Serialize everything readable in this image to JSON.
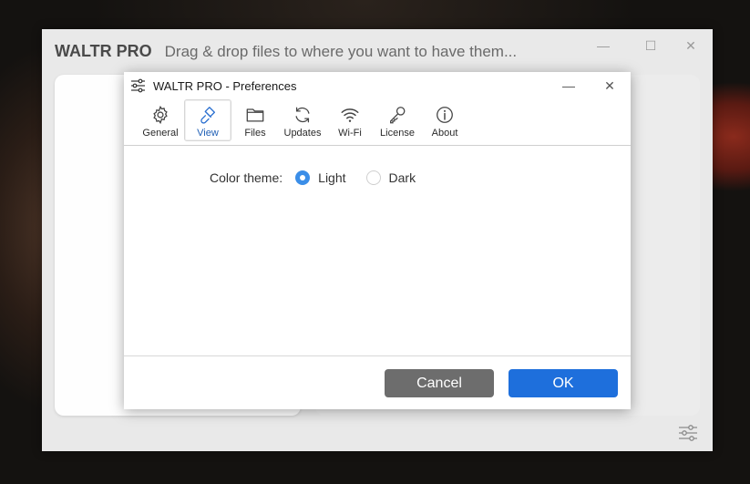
{
  "main_window": {
    "app_name": "WALTR PRO",
    "subtitle": "Drag & drop files to where you want to have them...",
    "controls": {
      "minimize": "—",
      "maximize": "☐",
      "close": "✕"
    },
    "settings_icon": "sliders-icon"
  },
  "dialog": {
    "title": "WALTR PRO - Preferences",
    "title_icon": "sliders-icon",
    "controls": {
      "minimize": "—",
      "close": "✕"
    },
    "tabs": [
      {
        "label": "General",
        "icon": "gear-icon",
        "active": false
      },
      {
        "label": "View",
        "icon": "brush-icon",
        "active": true
      },
      {
        "label": "Files",
        "icon": "folder-icon",
        "active": false
      },
      {
        "label": "Updates",
        "icon": "refresh-icon",
        "active": false
      },
      {
        "label": "Wi-Fi",
        "icon": "wifi-icon",
        "active": false
      },
      {
        "label": "License",
        "icon": "key-icon",
        "active": false
      },
      {
        "label": "About",
        "icon": "info-icon",
        "active": false
      }
    ],
    "color_theme": {
      "label": "Color theme:",
      "options": [
        {
          "label": "Light",
          "selected": true
        },
        {
          "label": "Dark",
          "selected": false
        }
      ]
    },
    "buttons": {
      "cancel": "Cancel",
      "ok": "OK"
    }
  },
  "colors": {
    "accent": "#1e6fdc",
    "radio_selected": "#3b8ee8",
    "cancel_button": "#6d6d6d",
    "active_tab_text": "#1f5fb5"
  }
}
